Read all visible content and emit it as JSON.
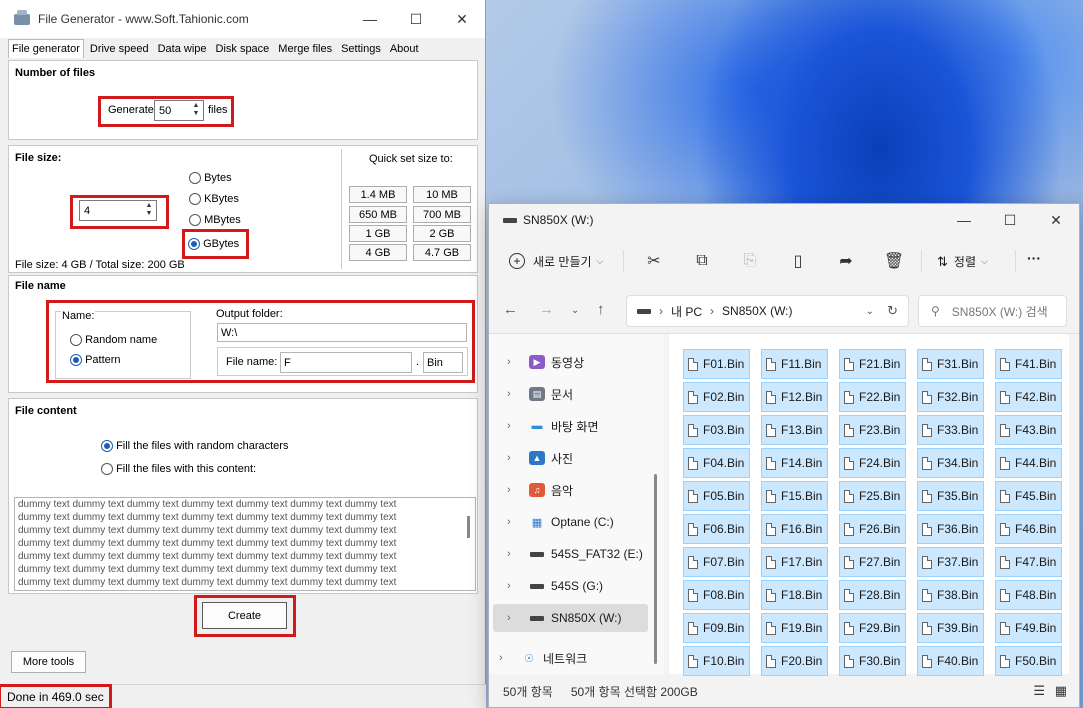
{
  "file_generator": {
    "title": "File Generator  -  www.Soft.Tahionic.com",
    "tabs": [
      "File generator",
      "Drive speed",
      "Data wipe",
      "Disk space",
      "Merge files",
      "Settings",
      "About"
    ],
    "number_of_files": {
      "heading": "Number of files",
      "generate_label": "Generate",
      "count": "50",
      "files_label": "files"
    },
    "file_size": {
      "heading": "File size:",
      "value": "4",
      "units": [
        "Bytes",
        "KBytes",
        "MBytes",
        "GBytes"
      ],
      "selected_unit": "GBytes",
      "summary": "File size: 4 GB / Total size: 200 GB",
      "quick_set_label": "Quick set size to:",
      "quick_set": [
        "1.4 MB",
        "10 MB",
        "650 MB",
        "700 MB",
        "1 GB",
        "2 GB",
        "4 GB",
        "4.7 GB"
      ]
    },
    "file_name": {
      "heading": "File name",
      "name_group": "Name:",
      "random_name": "Random name",
      "pattern": "Pattern",
      "selected": "Pattern",
      "output_folder_label": "Output folder:",
      "output_folder": "W:\\",
      "file_name_label": "File name:",
      "file_name_value": "F",
      "dot": ".",
      "extension": "Bin"
    },
    "file_content": {
      "heading": "File content",
      "random_option": "Fill the files with random characters",
      "content_option": "Fill the files with this content:",
      "selected": "random",
      "text_lines": [
        "dummy text dummy text dummy text dummy text dummy text dummy text dummy text",
        "dummy text dummy text dummy text dummy text dummy text dummy text dummy text",
        "dummy text dummy text dummy text dummy text dummy text dummy text dummy text",
        "dummy text dummy text dummy text dummy text dummy text dummy text dummy text",
        "dummy text dummy text dummy text dummy text dummy text dummy text dummy text",
        "dummy text dummy text dummy text dummy text dummy text dummy text dummy text",
        "dummy text dummy text dummy text dummy text dummy text dummy text dummy text"
      ]
    },
    "create_button": "Create",
    "more_tools_button": "More tools",
    "status": "Done in 469.0 sec"
  },
  "explorer": {
    "title": "SN850X (W:)",
    "toolbar": {
      "new_label": "새로 만들기",
      "sort_label": "정렬",
      "more": "···"
    },
    "breadcrumb": [
      "내 PC",
      "SN850X (W:)"
    ],
    "search_placeholder": "SN850X (W:) 검색",
    "nav_items": [
      {
        "label": "동영상",
        "icon": "video-icon"
      },
      {
        "label": "문서",
        "icon": "document-icon"
      },
      {
        "label": "바탕 화면",
        "icon": "desktop-icon"
      },
      {
        "label": "사진",
        "icon": "pictures-icon"
      },
      {
        "label": "음악",
        "icon": "music-icon"
      },
      {
        "label": "Optane (C:)",
        "icon": "windows-drive-icon"
      },
      {
        "label": "545S_FAT32 (E:)",
        "icon": "drive-icon"
      },
      {
        "label": "545S (G:)",
        "icon": "drive-icon"
      },
      {
        "label": "SN850X (W:)",
        "icon": "drive-icon",
        "selected": true
      },
      {
        "label": "네트워크",
        "icon": "network-icon"
      }
    ],
    "files": [
      "F01.Bin",
      "F02.Bin",
      "F03.Bin",
      "F04.Bin",
      "F05.Bin",
      "F06.Bin",
      "F07.Bin",
      "F08.Bin",
      "F09.Bin",
      "F10.Bin",
      "F11.Bin",
      "F12.Bin",
      "F13.Bin",
      "F14.Bin",
      "F15.Bin",
      "F16.Bin",
      "F17.Bin",
      "F18.Bin",
      "F19.Bin",
      "F20.Bin",
      "F21.Bin",
      "F22.Bin",
      "F23.Bin",
      "F24.Bin",
      "F25.Bin",
      "F26.Bin",
      "F27.Bin",
      "F28.Bin",
      "F29.Bin",
      "F30.Bin",
      "F31.Bin",
      "F32.Bin",
      "F33.Bin",
      "F34.Bin",
      "F35.Bin",
      "F36.Bin",
      "F37.Bin",
      "F38.Bin",
      "F39.Bin",
      "F40.Bin",
      "F41.Bin",
      "F42.Bin",
      "F43.Bin",
      "F44.Bin",
      "F45.Bin",
      "F46.Bin",
      "F47.Bin",
      "F48.Bin",
      "F49.Bin",
      "F50.Bin"
    ],
    "status_count": "50개 항목",
    "status_selected": "50개 항목 선택함 200GB"
  }
}
